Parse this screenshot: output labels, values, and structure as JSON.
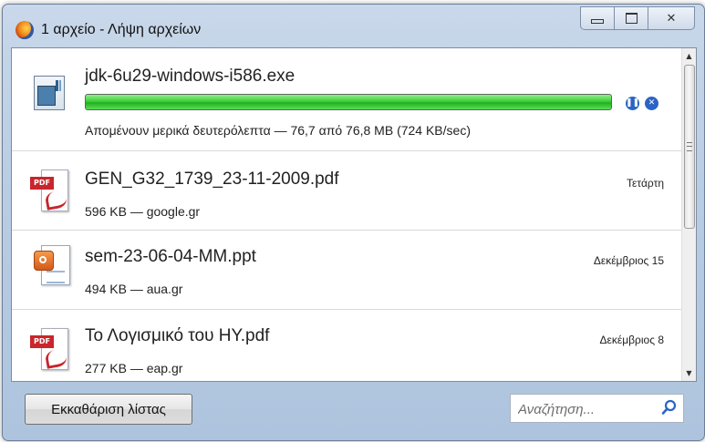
{
  "window": {
    "title": "1 αρχείο - Λήψη αρχείων",
    "accent_color": "#3fcf3a"
  },
  "downloads": [
    {
      "filename": "jdk-6u29-windows-i586.exe",
      "status": "Απομένουν μερικά δευτερόλεπτα — 76,7 από 76,8 MB (724 KB/sec)",
      "icon": "exe-icon",
      "progress_fraction": 0.999
    },
    {
      "filename": "GEN_G32_1739_23-11-2009.pdf",
      "meta": "596 KB — google.gr",
      "date": "Τετάρτη",
      "icon": "pdf-icon"
    },
    {
      "filename": "sem-23-06-04-MM.ppt",
      "meta": "494 KB — aua.gr",
      "date": "Δεκέμβριος 15",
      "icon": "ppt-icon"
    },
    {
      "filename": "Το Λογισμικό του ΗΥ.pdf",
      "meta": "277 KB — eap.gr",
      "date": "Δεκέμβριος 8",
      "icon": "pdf-icon"
    }
  ],
  "footer": {
    "clear_label": "Εκκαθάριση λίστας",
    "search_placeholder": "Αναζήτηση..."
  }
}
